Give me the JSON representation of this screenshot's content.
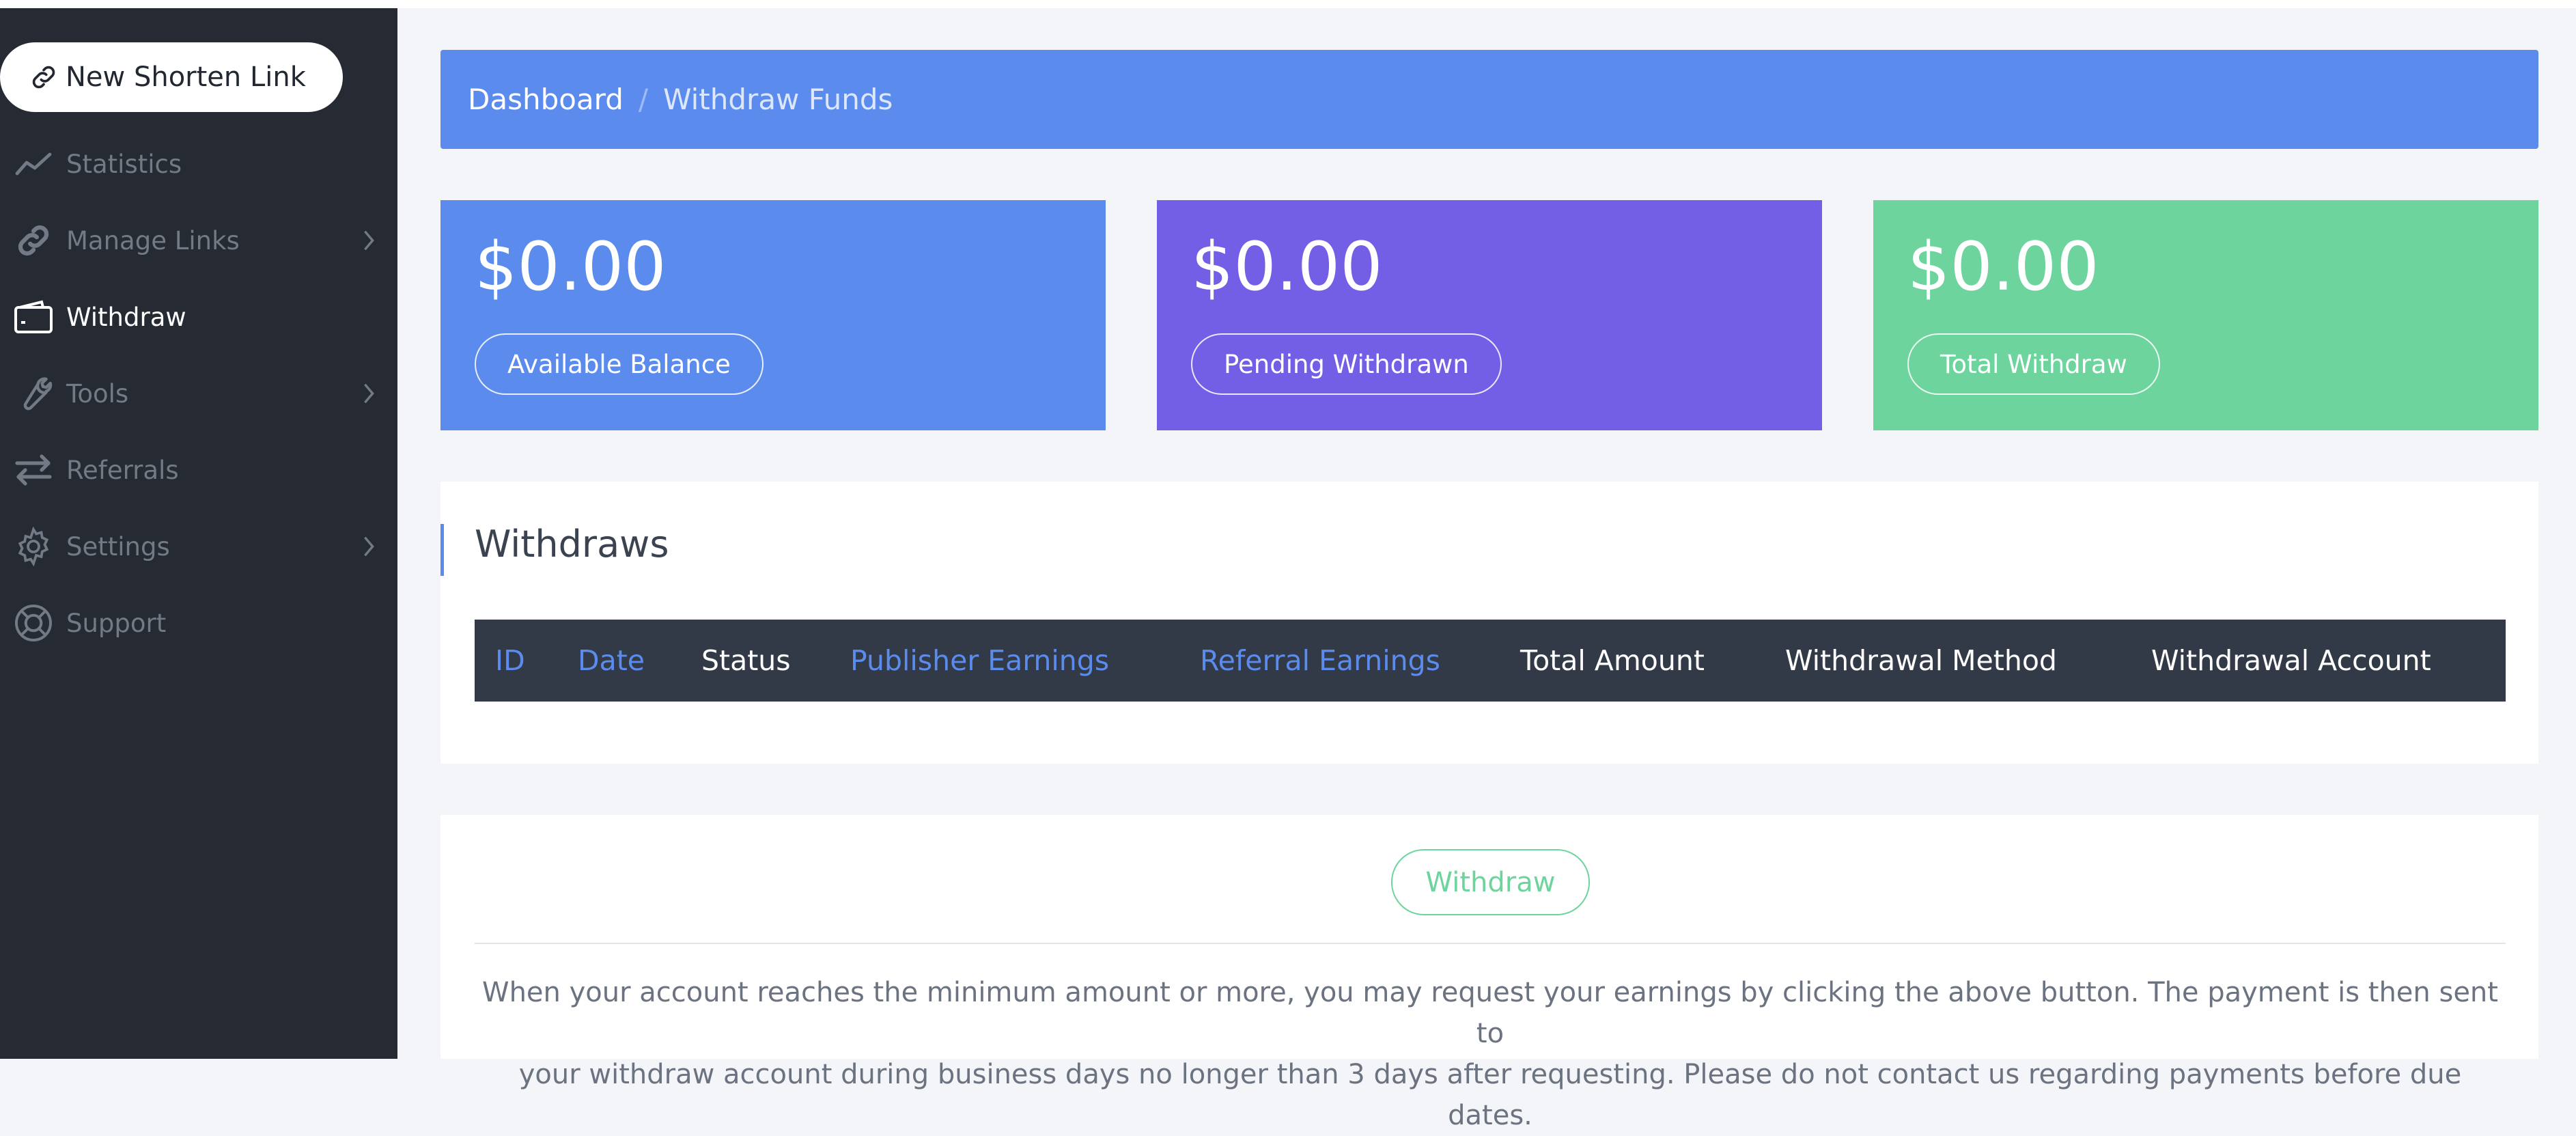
{
  "sidebar": {
    "new_link_label": "New Shorten Link",
    "items": [
      {
        "label": "Statistics",
        "icon": "chart-line-icon",
        "has_submenu": false,
        "active": false
      },
      {
        "label": "Manage Links",
        "icon": "link-icon",
        "has_submenu": true,
        "active": false
      },
      {
        "label": "Withdraw",
        "icon": "wallet-icon",
        "has_submenu": false,
        "active": true
      },
      {
        "label": "Tools",
        "icon": "wrench-icon",
        "has_submenu": true,
        "active": false
      },
      {
        "label": "Referrals",
        "icon": "exchange-icon",
        "has_submenu": false,
        "active": false
      },
      {
        "label": "Settings",
        "icon": "gear-icon",
        "has_submenu": true,
        "active": false
      },
      {
        "label": "Support",
        "icon": "life-ring-icon",
        "has_submenu": false,
        "active": false
      }
    ]
  },
  "breadcrumb": {
    "home": "Dashboard",
    "separator": "/",
    "current": "Withdraw Funds"
  },
  "stats": [
    {
      "amount": "$0.00",
      "label": "Available Balance",
      "color": "#5b8ced"
    },
    {
      "amount": "$0.00",
      "label": "Pending Withdrawn",
      "color": "#735fe6"
    },
    {
      "amount": "$0.00",
      "label": "Total Withdraw",
      "color": "#6ed49e"
    }
  ],
  "withdraws_panel": {
    "title": "Withdraws",
    "columns": [
      {
        "label": "ID",
        "sortable": true
      },
      {
        "label": "Date",
        "sortable": true
      },
      {
        "label": "Status",
        "sortable": false
      },
      {
        "label": "Publisher Earnings",
        "sortable": true
      },
      {
        "label": "Referral Earnings",
        "sortable": true
      },
      {
        "label": "Total Amount",
        "sortable": false
      },
      {
        "label": "Withdrawal Method",
        "sortable": false
      },
      {
        "label": "Withdrawal Account",
        "sortable": false
      }
    ],
    "rows": []
  },
  "withdraw_section": {
    "button_label": "Withdraw",
    "notice_line1": "When your account reaches the minimum amount or more, you may request your earnings by clicking the above button. The payment is then sent to",
    "notice_line2": "your withdraw account during business days no longer than 3 days after requesting. Please do not contact us regarding payments before due dates."
  },
  "colors": {
    "sidebar_bg": "#252a33",
    "accent_blue": "#5b8ced",
    "accent_purple": "#735fe6",
    "accent_green": "#6ed49e",
    "table_head_bg": "#323a48"
  }
}
